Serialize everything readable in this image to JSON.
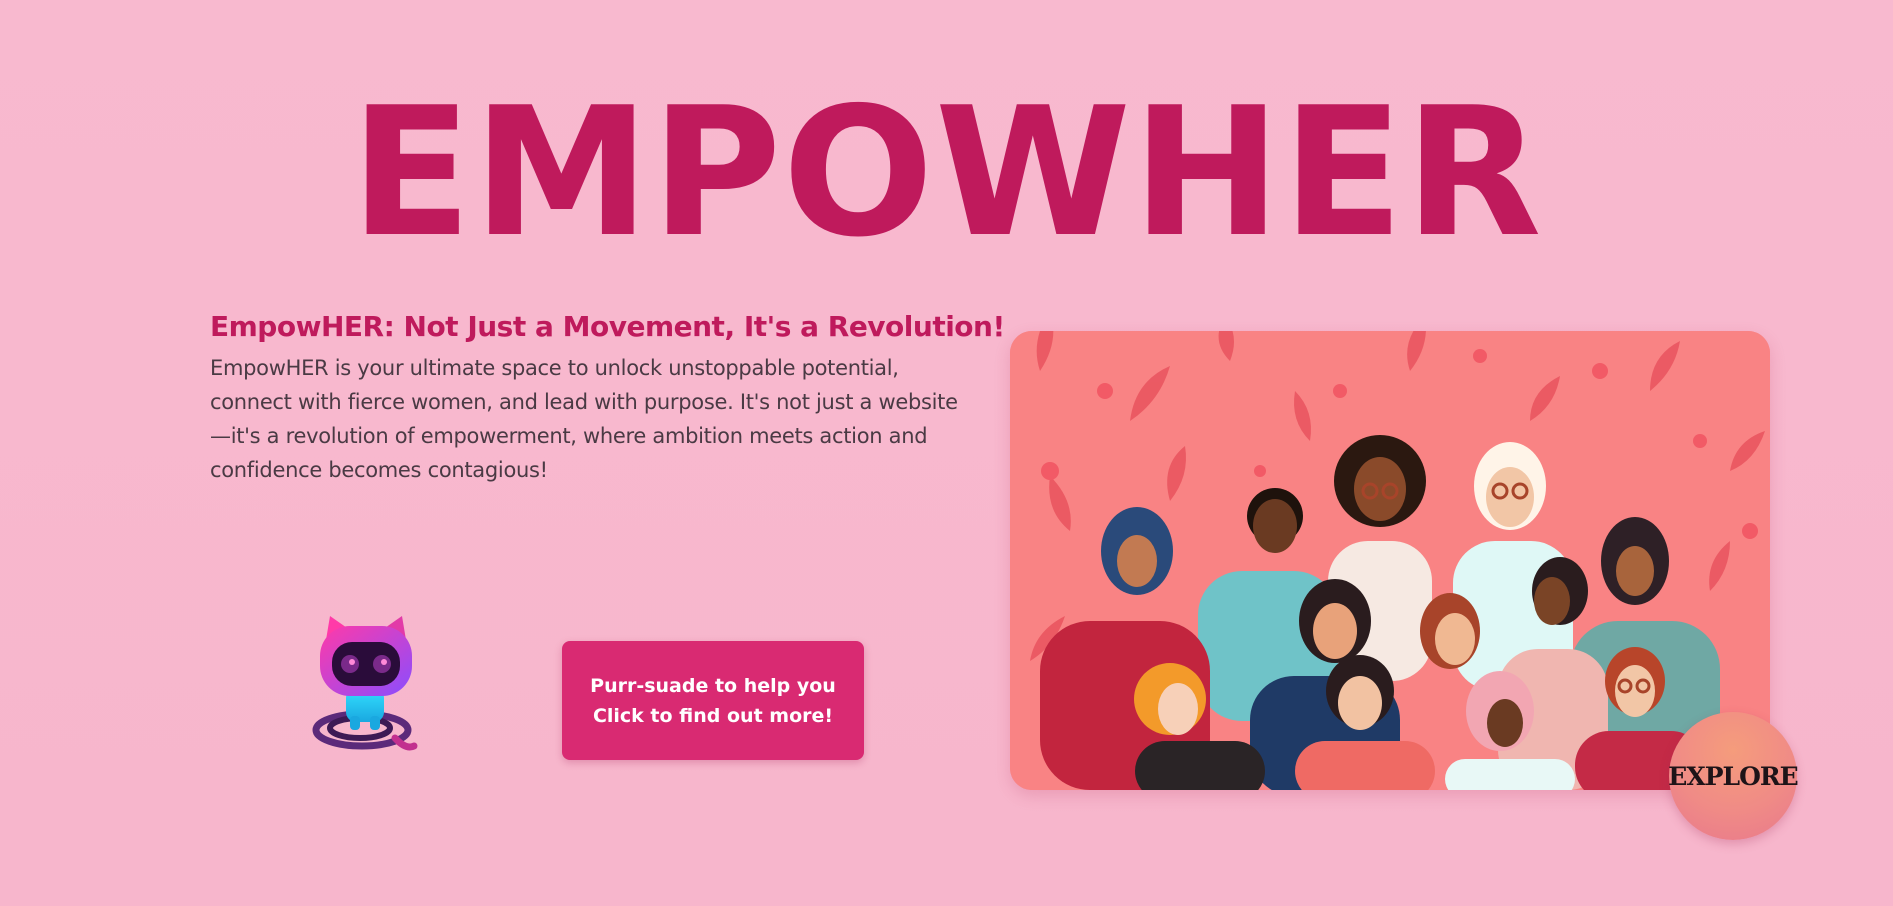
{
  "hero": {
    "title": "EMPOWHER"
  },
  "intro": {
    "subtitle": "EmpowHER: Not Just a Movement, It's a Revolution!",
    "body": "EmpowHER is your ultimate space to unlock unstoppable potential, connect with fierce women, and lead with purpose. It's not just a website—it's a revolution of empowerment, where ambition meets action and confidence becomes contagious!"
  },
  "mascot": {
    "icon": "cat-robot-icon"
  },
  "cta": {
    "line1": "Purr-suade to help you",
    "line2": "Click to find out more!"
  },
  "illustration": {
    "icon": "diverse-women-group-illustration"
  },
  "explore": {
    "label": "EXPLORE"
  },
  "colors": {
    "background": "#f8b9cf",
    "brand": "#bf1a5c",
    "button": "#d92a72",
    "illustration_bg": "#f98384"
  }
}
